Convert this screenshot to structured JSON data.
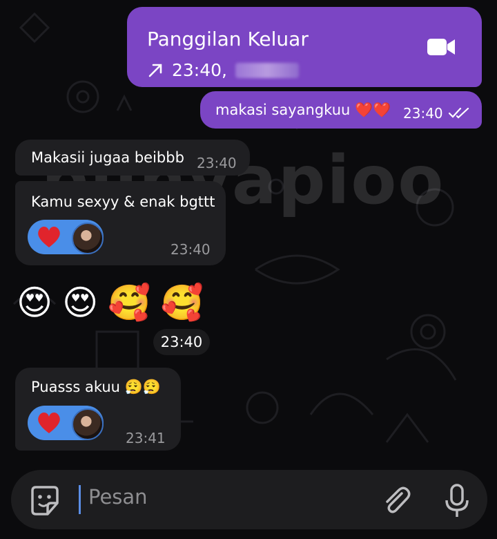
{
  "watermark": "punyapioo",
  "call": {
    "title": "Panggilan Keluar",
    "time": "23:40,",
    "direction_icon": "outgoing-arrow-icon",
    "action_icon": "video-camera-icon"
  },
  "messages": [
    {
      "text": "makasi sayangkuu ❤️❤️",
      "time": "23:40",
      "status_icon": "double-check-icon",
      "direction": "outgoing"
    },
    {
      "text": "Makasii jugaa beibbb",
      "time": "23:40",
      "direction": "incoming"
    },
    {
      "text": "Kamu sexyy & enak bgttt",
      "time": "23:40",
      "direction": "incoming",
      "reaction": "❤️"
    },
    {
      "emojis": [
        "😍",
        "😍",
        "🥰",
        "🥰"
      ],
      "time": "23:40",
      "direction": "incoming"
    },
    {
      "text": "Puasss akuu 😮‍💨😮‍💨",
      "time": "23:41",
      "direction": "incoming",
      "reaction": "❤️"
    }
  ],
  "composer": {
    "placeholder": "Pesan",
    "icons": [
      "sticker-icon",
      "attach-icon",
      "microphone-icon"
    ]
  },
  "colors": {
    "outgoing_bubble": "#7b45c4",
    "incoming_bubble": "#1f1f22",
    "reaction": "#4a8ee8",
    "background": "#0b0b0d"
  }
}
